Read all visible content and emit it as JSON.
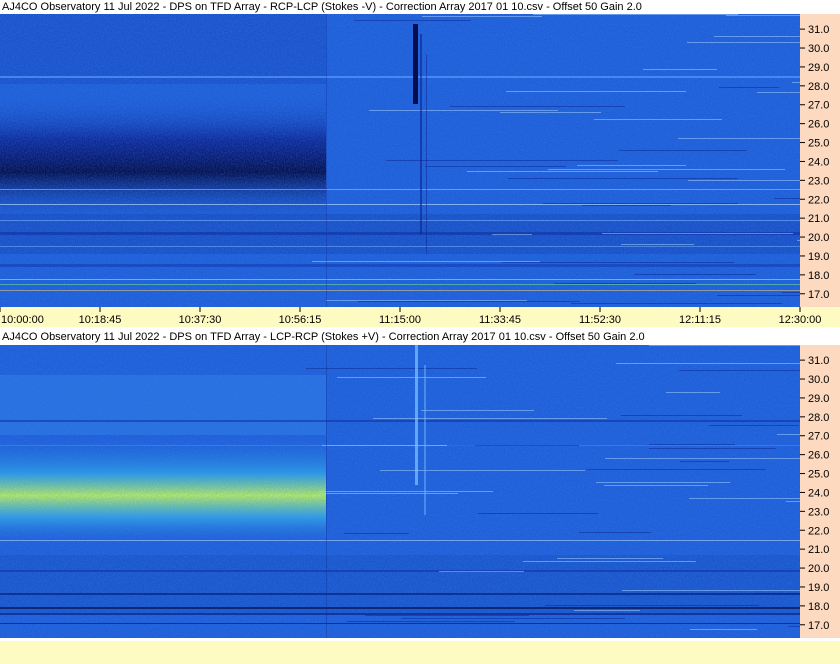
{
  "chart_data": [
    {
      "type": "heatmap",
      "title": "AJ4CO Observatory 11 Jul 2022  -  DPS on TFD Array  -  RCP-LCP (Stokes -V)  -  Correction Array 2017 01 10.csv  -  Offset 50  Gain 2.0",
      "y_ticks": [
        "31.0",
        "30.0",
        "29.0",
        "28.0",
        "27.0",
        "26.0",
        "25.0",
        "24.0",
        "23.0",
        "22.0",
        "21.0",
        "20.0",
        "19.0",
        "18.0",
        "17.0"
      ],
      "y_values": [
        31.0,
        30.0,
        29.0,
        28.0,
        27.0,
        26.0,
        25.0,
        24.0,
        23.0,
        22.0,
        21.0,
        20.0,
        19.0,
        18.0,
        17.0
      ],
      "ylim": [
        16.3,
        31.8
      ],
      "x_ticks": [
        "10:00:00",
        "10:18:45",
        "10:37:30",
        "10:56:15",
        "11:15:00",
        "11:33:45",
        "11:52:30",
        "12:11:15",
        "12:30:00"
      ],
      "x_values": [
        0,
        1125,
        2250,
        3375,
        4500,
        5625,
        6750,
        7875,
        9000
      ],
      "xlim": [
        0,
        9000
      ],
      "colors": {
        "low": "#040a45",
        "mid": "#1f5ed8",
        "high": "#7dfa8a"
      }
    },
    {
      "type": "heatmap",
      "title": "AJ4CO Observatory 11 Jul 2022  -  DPS on TFD Array  -  LCP-RCP (Stokes +V)  -  Correction Array 2017 01 10.csv  -  Offset 50  Gain 2.0",
      "y_ticks": [
        "31.0",
        "30.0",
        "29.0",
        "28.0",
        "27.0",
        "26.0",
        "25.0",
        "24.0",
        "23.0",
        "22.0",
        "21.0",
        "20.0",
        "19.0",
        "18.0",
        "17.0"
      ],
      "y_values": [
        31.0,
        30.0,
        29.0,
        28.0,
        27.0,
        26.0,
        25.0,
        24.0,
        23.0,
        22.0,
        21.0,
        20.0,
        19.0,
        18.0,
        17.0
      ],
      "ylim": [
        16.3,
        31.8
      ],
      "colors": {
        "low": "#040a45",
        "mid": "#1f5ed8",
        "high": "#bff25a"
      }
    }
  ]
}
